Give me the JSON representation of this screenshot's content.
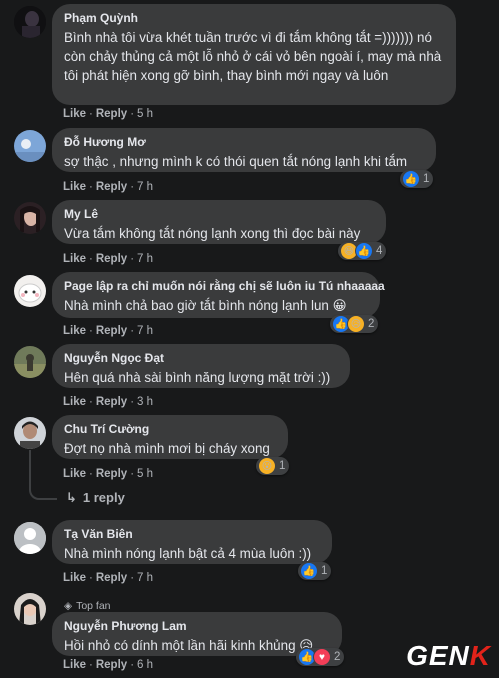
{
  "comments": [
    {
      "author": "Phạm Quỳnh",
      "text": "Bình nhà tôi vừa khét tuần trước vì đi tắm không tắt =))))))) nó còn chảy thủng cả một lỗ nhỏ ở cái vỏ bên ngoài í, may mà nhà tôi phát hiện xong gỡ bình, thay bình mới ngay và luôn",
      "like": "Like",
      "reply": "Reply",
      "time": "5 h",
      "reaction_count": ""
    },
    {
      "author": "Đỗ Hương Mơ",
      "text": "sợ thậc , nhưng mình k có thói quen tắt nóng lạnh khi tắm",
      "like": "Like",
      "reply": "Reply",
      "time": "7 h",
      "reaction_count": "1"
    },
    {
      "author": "My Lê",
      "text": "Vừa tắm không tắt nóng lạnh xong thì đọc bài này",
      "like": "Like",
      "reply": "Reply",
      "time": "7 h",
      "reaction_count": "4"
    },
    {
      "author": "Page lập ra chỉ muốn nói rằng chị sẽ luôn iu Tú nhaaaaa",
      "text": "Nhà mình chả bao giờ tắt bình nóng lạnh lun 😀",
      "like": "Like",
      "reply": "Reply",
      "time": "7 h",
      "reaction_count": "2"
    },
    {
      "author": "Nguyễn Ngọc Đạt",
      "text": "Hên quá nhà sài bình năng lượng mặt trời :))",
      "like": "Like",
      "reply": "Reply",
      "time": "3 h",
      "reaction_count": ""
    },
    {
      "author": "Chu Trí Cường",
      "text": "Đợt nọ nhà mình mơi bị cháy xong",
      "like": "Like",
      "reply": "Reply",
      "time": "5 h",
      "reaction_count": "1",
      "replies_label": "1 reply"
    },
    {
      "author": "Tạ Văn Biên",
      "text": "Nhà mình nóng lạnh bật cả 4 mùa luôn :))",
      "like": "Like",
      "reply": "Reply",
      "time": "7 h",
      "reaction_count": "1"
    },
    {
      "author": "Nguyễn Phương Lam",
      "badge": "Top fan",
      "text": "Hồi nhỏ có dính một lần hãi kinh khủng 😥",
      "like": "Like",
      "reply": "Reply",
      "time": "6 h",
      "reaction_count": "2"
    }
  ],
  "watermark": {
    "brand_main": "GEN",
    "brand_accent": "K"
  },
  "colors": {
    "background": "#18191a",
    "bubble": "#3a3b3c",
    "like_blue": "#1877f2",
    "love_red": "#f33e58"
  },
  "icons": {
    "like": "like-icon",
    "haha": "haha-icon",
    "love": "love-icon",
    "wow": "wow-icon",
    "sad": "sad-icon",
    "reply_arrow": "reply-arrow-icon",
    "top_fan": "diamond-icon"
  }
}
